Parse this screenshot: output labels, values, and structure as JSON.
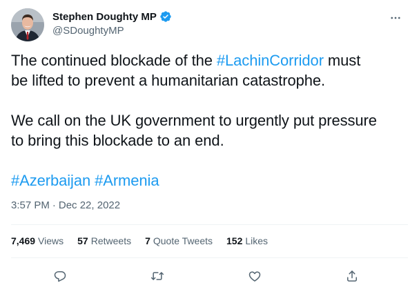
{
  "author": {
    "display_name": "Stephen Doughty MP",
    "handle": "@SDoughtyMP",
    "verified_icon": "verified-badge-icon"
  },
  "tweet": {
    "line1_pre": "The continued blockade of the ",
    "line1_hashtag": "#LachinCorridor",
    "line1_post": " must",
    "line2": "be lifted to prevent a humanitarian catastrophe.",
    "line3": "We call on the UK government to urgently put pressure",
    "line4": "to bring this blockade to an end.",
    "hashtag1": "#Azerbaijan",
    "hashtag2": "#Armenia"
  },
  "meta": {
    "time": "3:57 PM",
    "separator": "·",
    "date": "Dec 22, 2022"
  },
  "stats": {
    "views_count": "7,469",
    "views_label": "Views",
    "retweets_count": "57",
    "retweets_label": "Retweets",
    "quotes_count": "7",
    "quotes_label": "Quote Tweets",
    "likes_count": "152",
    "likes_label": "Likes"
  },
  "actions": [
    "reply-icon",
    "retweet-icon",
    "like-icon",
    "share-icon"
  ],
  "colors": {
    "accent": "#1d9bf0",
    "text": "#0f1419",
    "secondary": "#536471",
    "divider": "#eff3f4"
  }
}
